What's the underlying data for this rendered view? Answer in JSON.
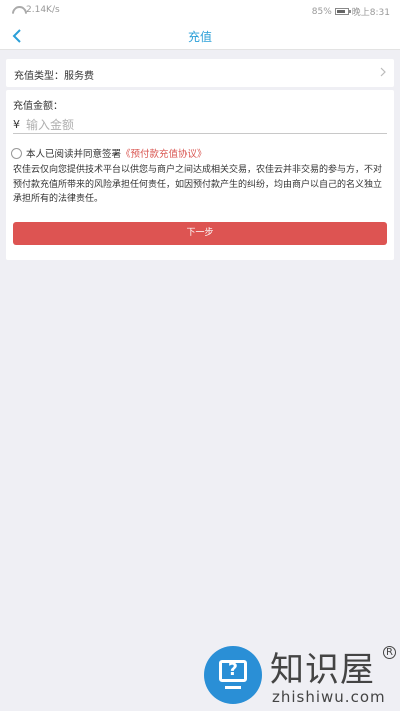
{
  "status_bar": {
    "network_speed": "2.14K/s",
    "battery_percent": "85%",
    "battery_level": 0.85,
    "time": "晚上8:31"
  },
  "nav": {
    "title": "充值",
    "back_icon": "chevron-left-icon"
  },
  "recharge_type": {
    "label": "充值类型：",
    "value": "服务费"
  },
  "amount": {
    "label": "充值金额：",
    "currency_symbol": "¥",
    "placeholder": "输入金额",
    "value": ""
  },
  "agreement": {
    "text": "本人已阅读并同意签署",
    "link": "《预付款充值协议》",
    "checked": false
  },
  "disclaimer": "农佳云仅向您提供技术平台以供您与商户之间达成相关交易，农佳云并非交易的参与方，不对预付款充值所带来的风险承担任何责任，如因预付款产生的纠纷，均由商户以自己的名义独立承担所有的法律责任。",
  "next_button": {
    "label": "下一步"
  },
  "watermark": {
    "title": "知识屋",
    "url": "zhishiwu.com",
    "registered_mark": "R"
  },
  "colors": {
    "accent": "#2a9fd8",
    "button": "#dd5452",
    "link": "#d95550",
    "background": "#efeff4"
  }
}
